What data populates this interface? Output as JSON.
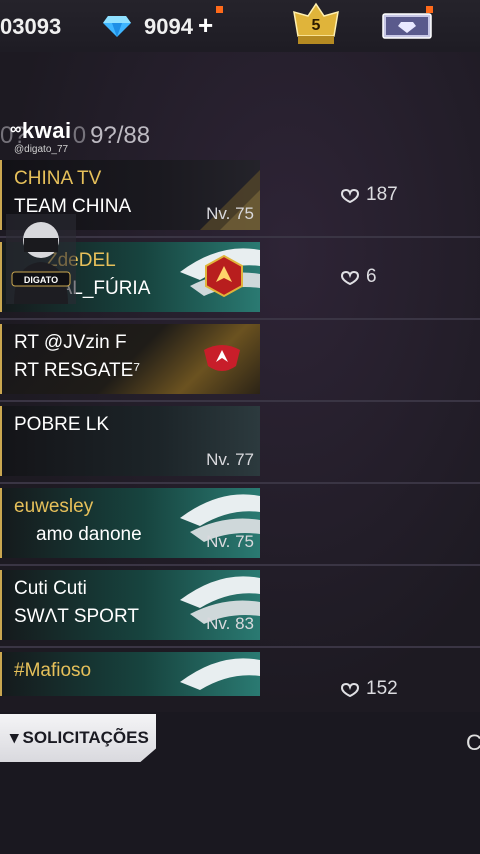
{
  "topbar": {
    "coins": "03093",
    "diamonds": "9094",
    "add_label": "+",
    "rank_level": "5",
    "icons": [
      "diamond-icon",
      "rank-crown-icon",
      "elite-pass-icon"
    ]
  },
  "watermark": {
    "logo": "kwai",
    "handle": "@digato_77"
  },
  "list": {
    "count": "9?/88",
    "count_prefix": "0?",
    "count_hidden": "0",
    "items": [
      {
        "line1": "CHINA   TV",
        "line2": "TEAM CHINA",
        "level": "Nv. 75",
        "likes": "187"
      },
      {
        "line1": "ZdeDEL",
        "line2": "RTAL_FÚRIA",
        "level": "",
        "likes": "6"
      },
      {
        "line1": "RT    @JVzin  F",
        "line2": "RT  RESGATE⁷",
        "level": "",
        "likes": ""
      },
      {
        "line1": "POBRE  LK",
        "line2": "",
        "level": "Nv. 77",
        "likes": ""
      },
      {
        "line1": "euwesley",
        "line2": "amo   danone",
        "level": "Nv. 75",
        "likes": ""
      },
      {
        "line1": "Cuti   Cuti",
        "line2": "SWΛT   SPORT",
        "level": "Nv. 83",
        "likes": ""
      },
      {
        "line1": "#Mafioso",
        "line2": "",
        "level": "",
        "likes": "152"
      }
    ]
  },
  "avatar_label": "DIGATO",
  "footer": {
    "requests_label": "SOLICITAÇÕES",
    "right_cut_text": "C"
  },
  "colors": {
    "gold": "#caa750",
    "teal": "#2a7a72",
    "background": "#1c1a22"
  }
}
